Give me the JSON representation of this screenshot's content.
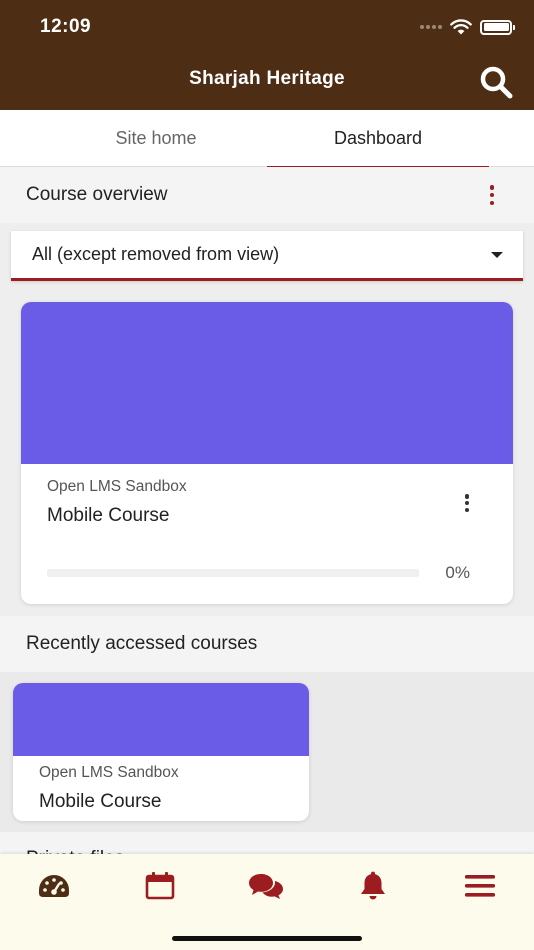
{
  "status_bar": {
    "time": "12:09"
  },
  "header": {
    "title": "Sharjah Heritage"
  },
  "tabs": [
    {
      "label": "Site home",
      "active": false
    },
    {
      "label": "Dashboard",
      "active": true
    }
  ],
  "course_overview": {
    "title": "Course overview",
    "filter": {
      "selected": "All (except removed from view)"
    },
    "courses": [
      {
        "category": "Open LMS Sandbox",
        "name": "Mobile Course",
        "progress": 0,
        "progress_label": "0%",
        "image_color": "#6b5ce7"
      }
    ]
  },
  "recent_courses": {
    "title": "Recently accessed courses",
    "courses": [
      {
        "category": "Open LMS Sandbox",
        "name": "Mobile Course",
        "image_color": "#6b5ce7"
      }
    ]
  },
  "private_files": {
    "title": "Private files"
  },
  "bottom_nav": {
    "items": [
      {
        "icon": "dashboard-icon",
        "label": "Dashboard"
      },
      {
        "icon": "calendar-icon",
        "label": "Calendar"
      },
      {
        "icon": "messages-icon",
        "label": "Messages"
      },
      {
        "icon": "notifications-icon",
        "label": "Notifications"
      },
      {
        "icon": "menu-icon",
        "label": "More"
      }
    ]
  },
  "colors": {
    "header_bg": "#4d2e14",
    "accent": "#9c1c20",
    "course_image": "#6b5ce7",
    "bottom_nav_bg": "#fdfbec",
    "dashboard_icon": "#4d2e14"
  }
}
